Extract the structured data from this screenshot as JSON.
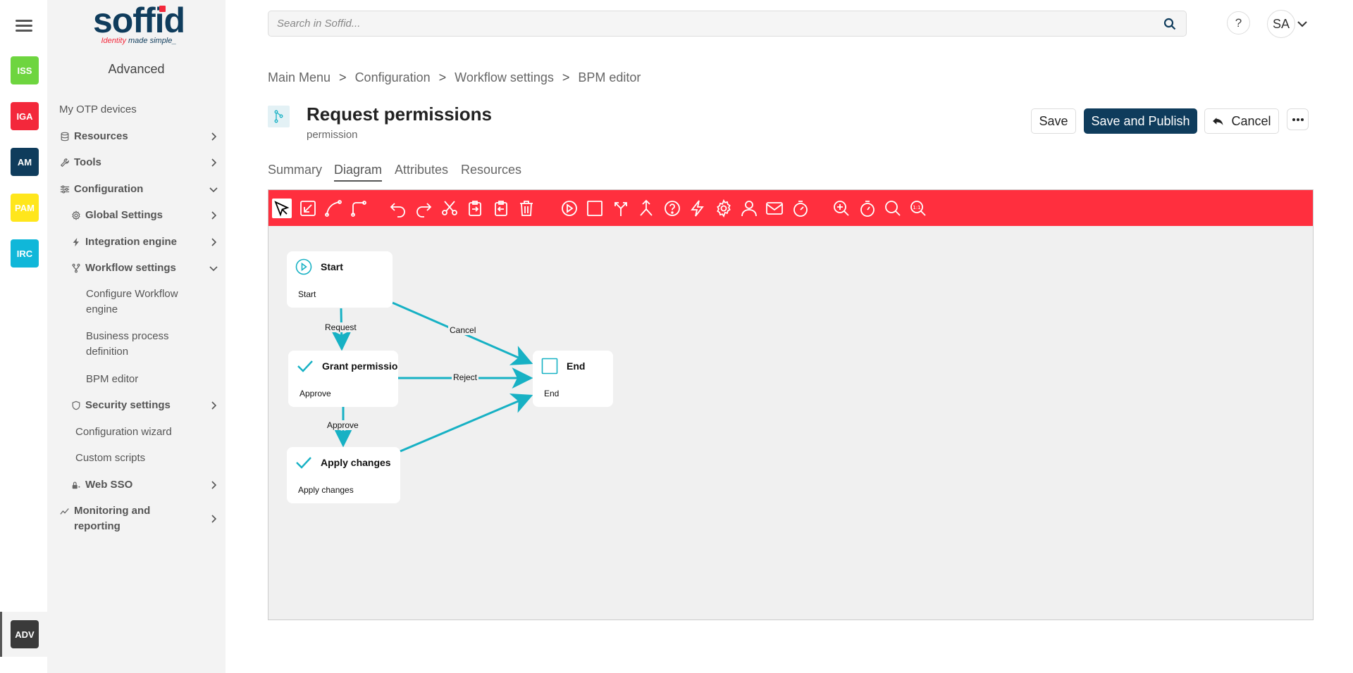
{
  "rail": {
    "apps": [
      {
        "label": "ISS",
        "color": "#6ed53f"
      },
      {
        "label": "IGA",
        "color": "#f3283b"
      },
      {
        "label": "AM",
        "color": "#0f3c5c"
      },
      {
        "label": "PAM",
        "color": "#ffe61c"
      },
      {
        "label": "IRC",
        "color": "#10b7d9"
      }
    ],
    "adv": {
      "label": "ADV",
      "color": "#3a3a3a"
    }
  },
  "logo": {
    "text": "soffid",
    "tagline_a": "Identity",
    "tagline_b": " made simple_"
  },
  "sidebar": {
    "title": "Advanced",
    "items": [
      {
        "label": "My OTP devices"
      },
      {
        "label": "Resources"
      },
      {
        "label": "Tools"
      },
      {
        "label": "Configuration"
      },
      {
        "label": "Global Settings"
      },
      {
        "label": "Integration engine"
      },
      {
        "label": "Workflow settings"
      },
      {
        "label": "Configure Workflow engine"
      },
      {
        "label": "Business process definition"
      },
      {
        "label": "BPM editor"
      },
      {
        "label": "Security settings"
      },
      {
        "label": "Configuration wizard"
      },
      {
        "label": "Custom scripts"
      },
      {
        "label": "Web SSO"
      },
      {
        "label": "Monitoring and reporting"
      }
    ]
  },
  "header": {
    "search_placeholder": "Search in Soffid...",
    "help": "?",
    "avatar": "SA"
  },
  "breadcrumb": [
    "Main Menu",
    "Configuration",
    "Workflow settings",
    "BPM editor"
  ],
  "breadcrumb_sep": ">",
  "page": {
    "title": "Request permissions",
    "subtitle": "permission"
  },
  "actions": {
    "save": "Save",
    "save_publish": "Save and Publish",
    "cancel": "Cancel"
  },
  "tabs": [
    "Summary",
    "Diagram",
    "Attributes",
    "Resources"
  ],
  "accent": "#17b1c4",
  "diagram": {
    "nodes": {
      "start": {
        "title": "Start",
        "sub": "Start"
      },
      "grant": {
        "title": "Grant permissions",
        "sub": "Approve"
      },
      "apply": {
        "title": "Apply changes",
        "sub": "Apply changes"
      },
      "end": {
        "title": "End",
        "sub": "End"
      }
    },
    "edges": {
      "request": "Request",
      "cancel": "Cancel",
      "reject": "Reject",
      "approve": "Approve"
    }
  }
}
